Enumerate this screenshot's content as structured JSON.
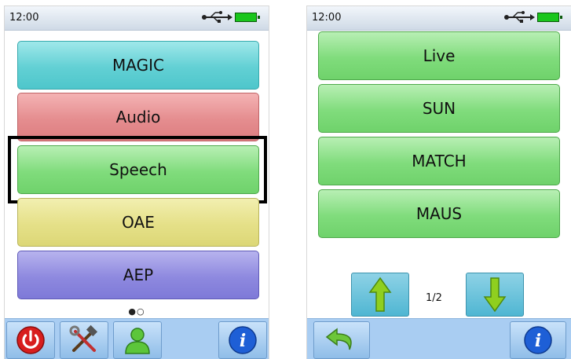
{
  "left_screen": {
    "status": {
      "time": "12:00",
      "usb_icon": "usb-icon",
      "battery_icon": "battery-icon"
    },
    "menu": [
      {
        "label": "MAGIC",
        "color": "#62d0d4"
      },
      {
        "label": "Audio",
        "color": "#e58d8f"
      },
      {
        "label": "Speech",
        "color": "#80dc7c",
        "selected": true
      },
      {
        "label": "OAE",
        "color": "#e5e088"
      },
      {
        "label": "AEP",
        "color": "#8e89df"
      }
    ],
    "page_dots": "●○",
    "toolbar": [
      {
        "icon": "power-icon"
      },
      {
        "icon": "tools-icon"
      },
      {
        "icon": "user-icon"
      },
      {
        "icon": "info-icon"
      }
    ]
  },
  "right_screen": {
    "status": {
      "time": "12:00",
      "usb_icon": "usb-icon",
      "battery_icon": "battery-icon"
    },
    "menu": [
      {
        "label": "Live"
      },
      {
        "label": "SUN"
      },
      {
        "label": "MATCH"
      },
      {
        "label": "MAUS"
      }
    ],
    "pagination": {
      "up_icon": "arrow-up-icon",
      "page": "1/2",
      "down_icon": "arrow-down-icon"
    },
    "toolbar": [
      {
        "icon": "back-icon"
      },
      {
        "icon": "info-icon"
      }
    ]
  },
  "colors": {
    "selection_frame": "#000000",
    "toolbar_bg": "#a9cdf2",
    "battery": "#19c61c"
  }
}
